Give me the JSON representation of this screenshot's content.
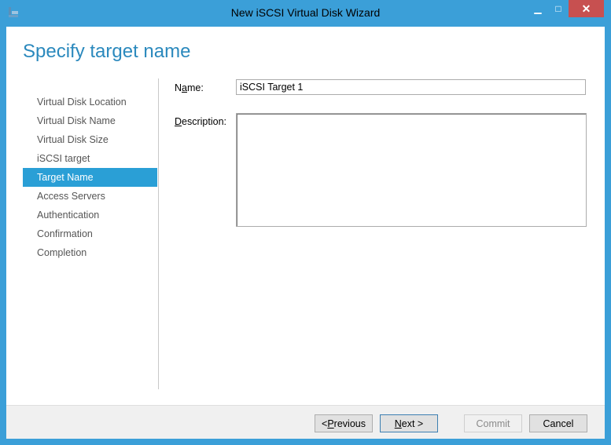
{
  "window": {
    "title": "New iSCSI Virtual Disk Wizard",
    "minimize_glyph": "▁",
    "maximize_glyph": "□",
    "close_glyph": "✕"
  },
  "page": {
    "heading": "Specify target name"
  },
  "nav": {
    "items": [
      {
        "label": "Virtual Disk Location",
        "active": false
      },
      {
        "label": "Virtual Disk Name",
        "active": false
      },
      {
        "label": "Virtual Disk Size",
        "active": false
      },
      {
        "label": "iSCSI target",
        "active": false
      },
      {
        "label": "Target Name",
        "active": true
      },
      {
        "label": "Access Servers",
        "active": false
      },
      {
        "label": "Authentication",
        "active": false
      },
      {
        "label": "Confirmation",
        "active": false
      },
      {
        "label": "Completion",
        "active": false
      }
    ]
  },
  "form": {
    "name_label_pre": "N",
    "name_label_mnemonic": "a",
    "name_label_post": "me:",
    "name_value": "iSCSI Target 1",
    "description_label_pre": "",
    "description_label_mnemonic": "D",
    "description_label_post": "escription:",
    "description_value": ""
  },
  "buttons": {
    "previous_pre": "< ",
    "previous_mnemonic": "P",
    "previous_post": "revious",
    "next_mnemonic": "N",
    "next_post": "ext >",
    "commit": "Commit",
    "cancel": "Cancel"
  },
  "colors": {
    "accent": "#2a9fd6",
    "heading": "#2b89bd",
    "frame": "#3b9fd8"
  }
}
